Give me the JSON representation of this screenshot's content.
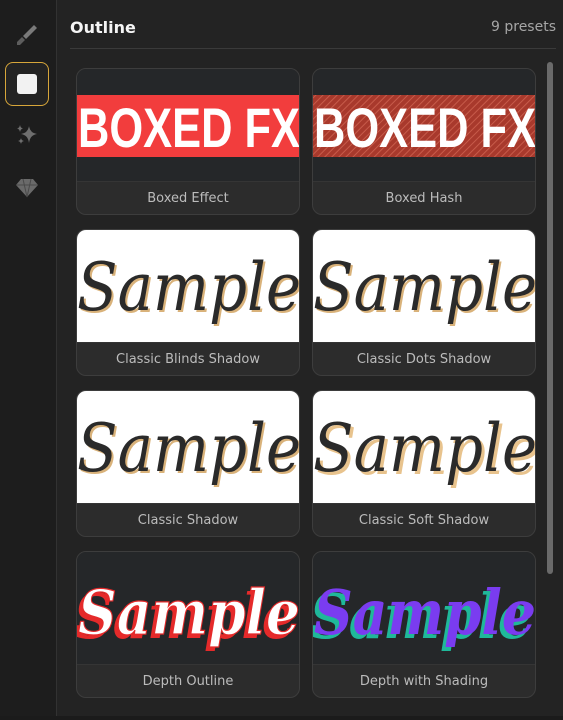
{
  "rail": {
    "items": [
      {
        "name": "brush",
        "icon": "brush-icon"
      },
      {
        "name": "outline",
        "icon": "square-icon",
        "active": true
      },
      {
        "name": "effects",
        "icon": "sparkles-icon"
      },
      {
        "name": "premium",
        "icon": "diamond-icon"
      }
    ]
  },
  "panel": {
    "title": "Outline",
    "count": "9 presets"
  },
  "presets": [
    {
      "label": "Boxed Effect",
      "preview_text": "BOXED FX",
      "style": "boxed"
    },
    {
      "label": "Boxed Hash",
      "preview_text": "BOXED FX",
      "style": "boxed-hash"
    },
    {
      "label": "Classic Blinds Shadow",
      "preview_text": "Sample",
      "style": "script"
    },
    {
      "label": "Classic Dots Shadow",
      "preview_text": "Sample",
      "style": "script"
    },
    {
      "label": "Classic Shadow",
      "preview_text": "Sample",
      "style": "script"
    },
    {
      "label": "Classic Soft Shadow",
      "preview_text": "Sample",
      "style": "script"
    },
    {
      "label": "Depth Outline",
      "preview_text": "Sample",
      "style": "depth-red"
    },
    {
      "label": "Depth with Shading",
      "preview_text": "Sample",
      "style": "depth-violet"
    }
  ],
  "colors": {
    "accent": "#d7a63a",
    "boxed_red": "#f23d3d",
    "hash_red": "#a8392c",
    "script_dark": "#2a2a2a",
    "script_shadow": "#d9b27a",
    "depth_red": "#e52a2a",
    "depth_violet": "#7a3cf0",
    "depth_teal": "#1fb89a"
  }
}
